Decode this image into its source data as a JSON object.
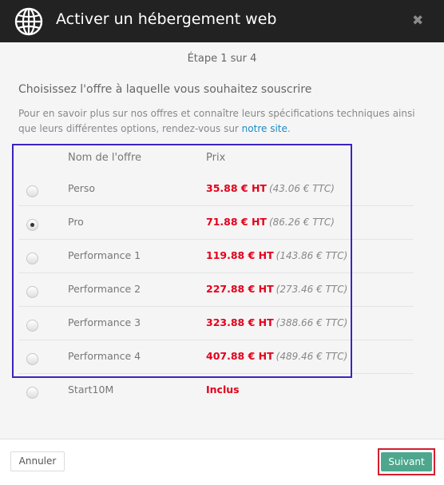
{
  "dialog": {
    "title": "Activer un hébergement web",
    "close_glyph": "✖",
    "globe_icon": "globe-icon"
  },
  "step": "Étape 1 sur 4",
  "heading": "Choisissez l'offre à laquelle vous souhaitez souscrire",
  "description": {
    "text": "Pour en savoir plus sur nos offres et connaître leurs spécifications techniques ainsi que leurs différentes options, rendez-vous sur ",
    "link": "notre site",
    "end": "."
  },
  "table": {
    "col_name": "Nom de l'offre",
    "col_price": "Prix",
    "rows": [
      {
        "name": "Perso",
        "ht": "35.88 € HT",
        "ttc": "(43.06 € TTC)",
        "selected": false
      },
      {
        "name": "Pro",
        "ht": "71.88 € HT",
        "ttc": "(86.26 € TTC)",
        "selected": true
      },
      {
        "name": "Performance 1",
        "ht": "119.88 € HT",
        "ttc": "(143.86 € TTC)",
        "selected": false
      },
      {
        "name": "Performance 2",
        "ht": "227.88 € HT",
        "ttc": "(273.46 € TTC)",
        "selected": false
      },
      {
        "name": "Performance 3",
        "ht": "323.88 € HT",
        "ttc": "(388.66 € TTC)",
        "selected": false
      },
      {
        "name": "Performance 4",
        "ht": "407.88 € HT",
        "ttc": "(489.46 € TTC)",
        "selected": false
      },
      {
        "name": "Start10M",
        "ht": "Inclus",
        "ttc": "",
        "selected": false
      }
    ]
  },
  "footer": {
    "cancel_label": "Annuler",
    "next_label": "Suivant"
  },
  "colors": {
    "header_bg": "#222222",
    "price_red": "#e3001b",
    "next_button": "#4ea78d",
    "link": "#1b8ac8",
    "highlight_frame": "#3a24c0",
    "next_frame": "#d21f2f"
  }
}
